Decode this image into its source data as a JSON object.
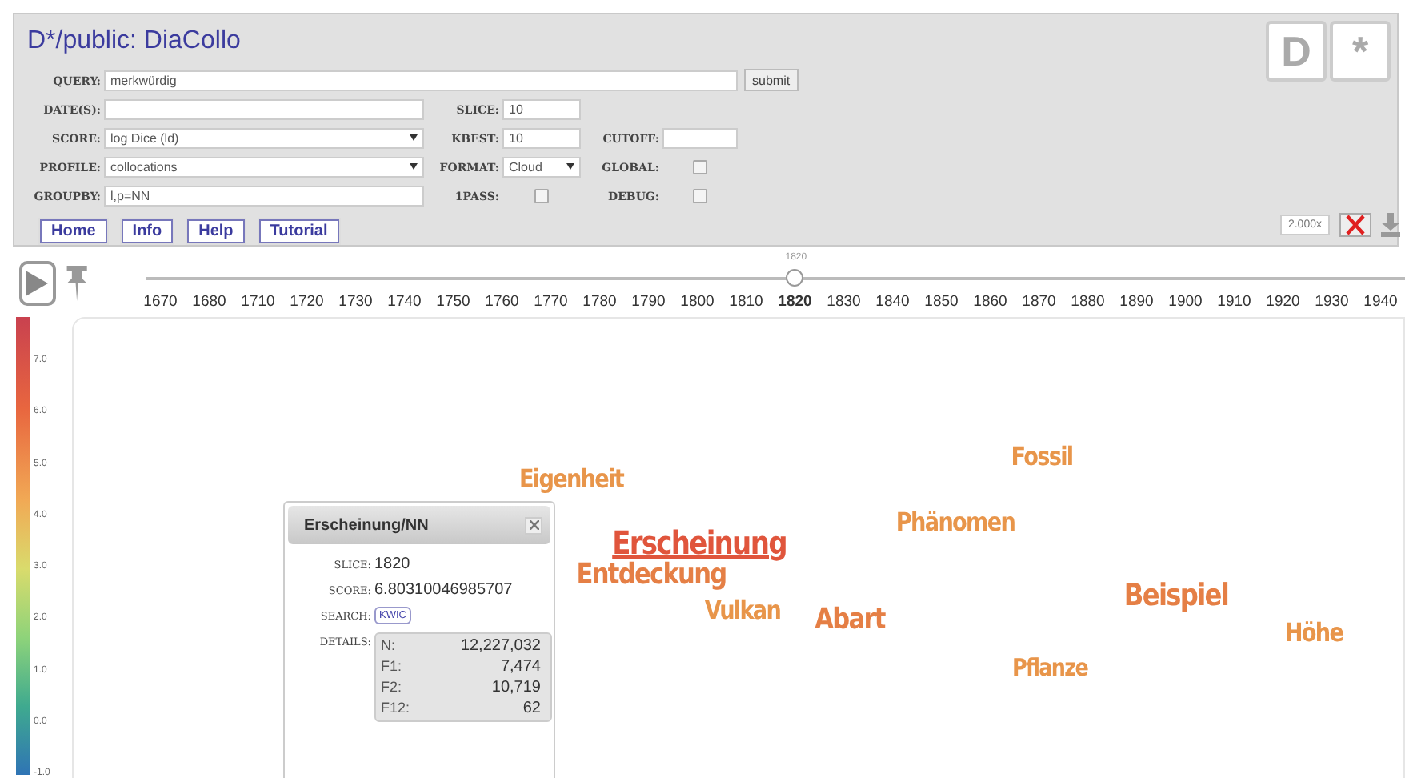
{
  "header": {
    "title": "D*/public: DiaCollo",
    "logos": [
      "D",
      "*"
    ]
  },
  "form_rows": [
    [
      {
        "kind": "wide_text",
        "label": "QUERY:",
        "value": "merkwürdig"
      },
      {
        "kind": "button",
        "value": "submit"
      }
    ],
    [
      {
        "kind": "text",
        "label": "DATE(S):"
      },
      {
        "kind": "text",
        "label": "SLICE:",
        "value": "10"
      }
    ],
    [
      {
        "kind": "select",
        "label": "SCORE:",
        "value": "log Dice (ld)"
      },
      {
        "kind": "text",
        "label": "KBEST:",
        "value": "10"
      },
      {
        "kind": "text",
        "label": "CUTOFF:"
      }
    ],
    [
      {
        "kind": "select",
        "label": "PROFILE:",
        "value": "collocations"
      },
      {
        "kind": "select",
        "label": "FORMAT:",
        "value": "Cloud"
      },
      {
        "kind": "checkbox",
        "label": "GLOBAL:",
        "checked": false
      }
    ],
    [
      {
        "kind": "text",
        "label": "GROUPBY:",
        "value": "l,p=NN"
      },
      {
        "kind": "checkbox",
        "label": "1PASS:",
        "checked": false
      },
      {
        "kind": "checkbox",
        "label": "DEBUG:",
        "checked": false
      }
    ]
  ],
  "nav_buttons": [
    "Home",
    "Info",
    "Help",
    "Tutorial"
  ],
  "speed": "2.000x",
  "timeline": {
    "thumb_label": "1820",
    "years": [
      {
        "label": "1670",
        "selected": false
      },
      {
        "label": "1680",
        "selected": false
      },
      {
        "label": "1710",
        "selected": false
      },
      {
        "label": "1720",
        "selected": false
      },
      {
        "label": "1730",
        "selected": false
      },
      {
        "label": "1740",
        "selected": false
      },
      {
        "label": "1750",
        "selected": false
      },
      {
        "label": "1760",
        "selected": false
      },
      {
        "label": "1770",
        "selected": false
      },
      {
        "label": "1780",
        "selected": false
      },
      {
        "label": "1790",
        "selected": false
      },
      {
        "label": "1800",
        "selected": false
      },
      {
        "label": "1810",
        "selected": false
      },
      {
        "label": "1820",
        "selected": true
      },
      {
        "label": "1830",
        "selected": false
      },
      {
        "label": "1840",
        "selected": false
      },
      {
        "label": "1850",
        "selected": false
      },
      {
        "label": "1860",
        "selected": false
      },
      {
        "label": "1870",
        "selected": false
      },
      {
        "label": "1880",
        "selected": false
      },
      {
        "label": "1890",
        "selected": false
      },
      {
        "label": "1900",
        "selected": false
      },
      {
        "label": "1910",
        "selected": false
      },
      {
        "label": "1920",
        "selected": false
      },
      {
        "label": "1930",
        "selected": false
      },
      {
        "label": "1940",
        "selected": false
      }
    ]
  },
  "legend_ticks": [
    "7.0",
    "6.0",
    "5.0",
    "4.0",
    "3.0",
    "2.0",
    "1.0",
    "0.0",
    "-1.0"
  ],
  "cloud": [
    {
      "word": "Eigenheit",
      "color": "#e8954a",
      "selected": false
    },
    {
      "word": "Fossil",
      "color": "#e8954a",
      "selected": false
    },
    {
      "word": "Phänomen",
      "color": "#e8954a",
      "selected": false
    },
    {
      "word": "Erscheinung",
      "color": "#e0553c",
      "selected": true
    },
    {
      "word": "Entdeckung",
      "color": "#e57f45",
      "selected": false
    },
    {
      "word": "Vulkan",
      "color": "#e8954a",
      "selected": false
    },
    {
      "word": "Abart",
      "color": "#e57f45",
      "selected": false
    },
    {
      "word": "Beispiel",
      "color": "#e57f45",
      "selected": false
    },
    {
      "word": "Höhe",
      "color": "#e8954a",
      "selected": false
    },
    {
      "word": "Pflanze",
      "color": "#e8954a",
      "selected": false
    }
  ],
  "popup": {
    "title": "Erscheinung/NN",
    "slice_label": "SLICE:",
    "slice": "1820",
    "score_label": "SCORE:",
    "score": "6.80310046985707",
    "search_label": "SEARCH:",
    "search_button": "KWIC",
    "details_label": "DETAILS:",
    "details": [
      {
        "key": "N:",
        "value": "12,227,032"
      },
      {
        "key": "F1:",
        "value": "7,474"
      },
      {
        "key": "F2:",
        "value": "10,719"
      },
      {
        "key": "F12:",
        "value": "62"
      }
    ]
  }
}
